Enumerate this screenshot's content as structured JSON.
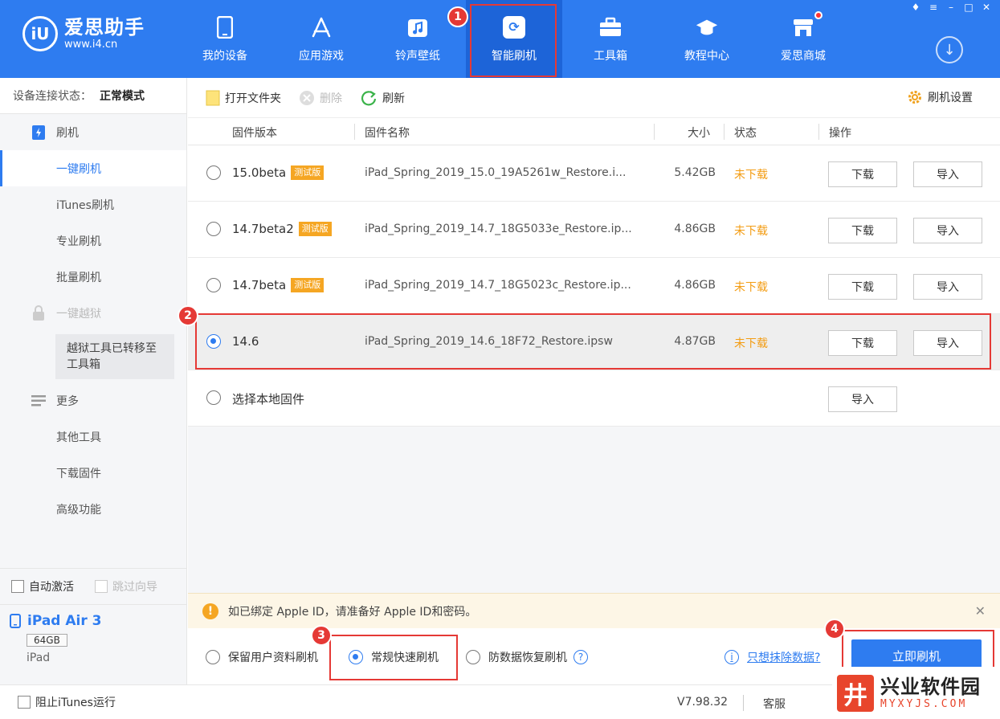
{
  "app": {
    "logo_mark": "iU",
    "logo_name": "爱思助手",
    "logo_url": "www.i4.cn"
  },
  "nav": [
    {
      "label": "我的设备",
      "icon": "phone-icon"
    },
    {
      "label": "应用游戏",
      "icon": "appstore-icon"
    },
    {
      "label": "铃声壁纸",
      "icon": "music-icon"
    },
    {
      "label": "智能刷机",
      "icon": "flash-icon"
    },
    {
      "label": "工具箱",
      "icon": "toolbox-icon"
    },
    {
      "label": "教程中心",
      "icon": "graduation-icon"
    },
    {
      "label": "爱思商城",
      "icon": "shop-icon"
    }
  ],
  "annotations": {
    "n1": "1",
    "n2": "2",
    "n3": "3",
    "n4": "4"
  },
  "sidebar": {
    "conn_label": "设备连接状态：",
    "conn_value": "正常模式",
    "flash_section": "刷机",
    "items_flash": [
      "一键刷机",
      "iTunes刷机",
      "专业刷机",
      "批量刷机"
    ],
    "jailbreak_section": "一键越狱",
    "jailbreak_note": "越狱工具已转移至工具箱",
    "more_section": "更多",
    "items_more": [
      "其他工具",
      "下载固件",
      "高级功能"
    ],
    "auto_activate": "自动激活",
    "skip_guide": "跳过向导",
    "device_name": "iPad Air 3",
    "device_capacity": "64GB",
    "device_type": "iPad"
  },
  "toolbar": {
    "open_folder": "打开文件夹",
    "delete": "删除",
    "refresh": "刷新",
    "settings": "刷机设置"
  },
  "table": {
    "headers": {
      "version": "固件版本",
      "name": "固件名称",
      "size": "大小",
      "status": "状态",
      "action": "操作"
    },
    "rows": [
      {
        "version": "15.0beta",
        "tag": "测试版",
        "name": "iPad_Spring_2019_15.0_19A5261w_Restore.i...",
        "size": "5.42GB",
        "status": "未下载",
        "download": "下载",
        "import": "导入"
      },
      {
        "version": "14.7beta2",
        "tag": "测试版",
        "name": "iPad_Spring_2019_14.7_18G5033e_Restore.ip...",
        "size": "4.86GB",
        "status": "未下载",
        "download": "下载",
        "import": "导入"
      },
      {
        "version": "14.7beta",
        "tag": "测试版",
        "name": "iPad_Spring_2019_14.7_18G5023c_Restore.ip...",
        "size": "4.86GB",
        "status": "未下载",
        "download": "下载",
        "import": "导入"
      },
      {
        "version": "14.6",
        "tag": "",
        "name": "iPad_Spring_2019_14.6_18F72_Restore.ipsw",
        "size": "4.87GB",
        "status": "未下载",
        "download": "下载",
        "import": "导入"
      }
    ],
    "local_label": "选择本地固件",
    "local_import": "导入"
  },
  "notice": {
    "text": "如已绑定 Apple ID，请准备好 Apple ID和密码。"
  },
  "flash_options": {
    "keep_data": "保留用户资料刷机",
    "quick": "常规快速刷机",
    "recovery": "防数据恢复刷机",
    "erase_link": "只想抹除数据?",
    "flash_button": "立即刷机"
  },
  "footer": {
    "block_itunes": "阻止iTunes运行",
    "version": "V7.98.32",
    "service": "客服"
  },
  "watermark": {
    "logo": "井",
    "name": "兴业软件园",
    "url": "MYXYJS.COM"
  },
  "colors": {
    "brand": "#2e7cf0",
    "annotation": "#e53935",
    "warning": "#f5a623",
    "status": "#f39c12"
  }
}
